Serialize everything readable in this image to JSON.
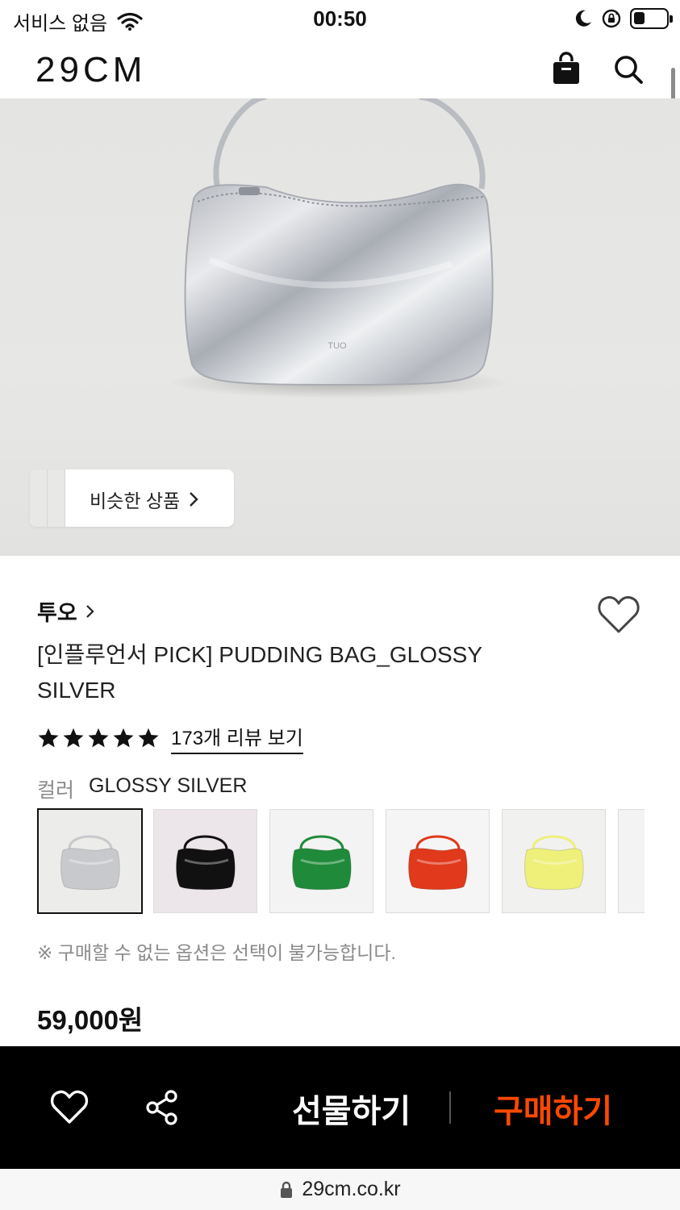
{
  "status_bar": {
    "carrier": "서비스 없음",
    "time": "00:50",
    "battery_level": 0.35
  },
  "header": {
    "logo": "29CM",
    "icons": [
      "shopping-bag-icon",
      "search-icon"
    ]
  },
  "hero": {
    "bag_label": "TUO",
    "similar_button_label": "비슷한 상품"
  },
  "product": {
    "brand": "투오",
    "title": "[인플루언서 PICK] PUDDING BAG_GLOSSY SILVER",
    "rating_stars": 5,
    "review_link": "173개 리뷰 보기",
    "color_label": "컬러",
    "color_value": "GLOSSY SILVER",
    "swatches": [
      {
        "name": "silver",
        "color": "#c7c9cc",
        "bg": "#ececea",
        "selected": true
      },
      {
        "name": "black",
        "color": "#111111",
        "bg": "#ece6ea",
        "selected": false
      },
      {
        "name": "green",
        "color": "#1f8a3a",
        "bg": "#f3f3f3",
        "selected": false
      },
      {
        "name": "red",
        "color": "#e0391c",
        "bg": "#f5f5f5",
        "selected": false
      },
      {
        "name": "yellow",
        "color": "#eef07a",
        "bg": "#f1f1ef",
        "selected": false
      },
      {
        "name": "more",
        "color": "#dddddd",
        "bg": "#f3f3f3",
        "selected": false
      }
    ],
    "notice": "※ 구매할 수 없는 옵션은 선택이 불가능합니다.",
    "price": "59,000원"
  },
  "action_bar": {
    "gift_label": "선물하기",
    "buy_label": "구매하기",
    "buy_color": "#ff4800"
  },
  "url_bar": {
    "url": "29cm.co.kr"
  }
}
